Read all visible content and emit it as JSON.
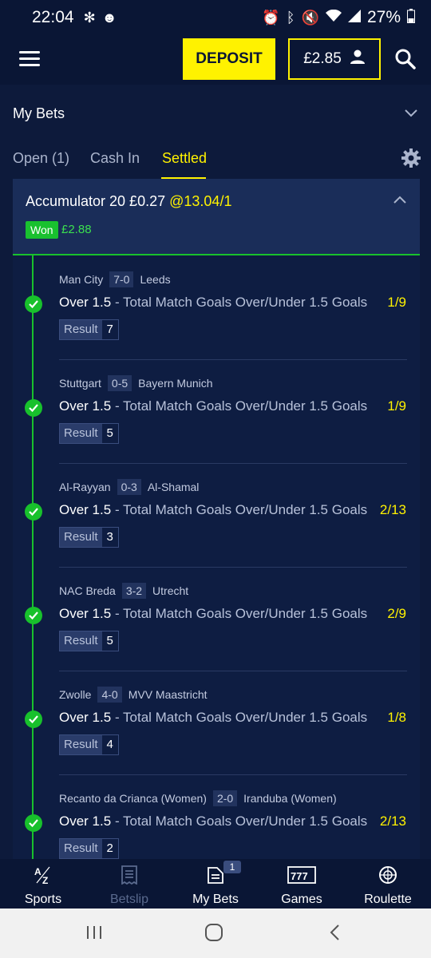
{
  "status_bar": {
    "time": "22:04",
    "battery": "27%"
  },
  "header": {
    "deposit_label": "DEPOSIT",
    "balance": "£2.85"
  },
  "my_bets": {
    "title": "My Bets",
    "tabs": [
      {
        "label": "Open (1)",
        "active": false
      },
      {
        "label": "Cash In",
        "active": false
      },
      {
        "label": "Settled",
        "active": true
      }
    ]
  },
  "bet": {
    "title": "Accumulator 20 £0.27",
    "odds": "@13.04/1",
    "status": "Won",
    "returns": "£2.88",
    "legs": [
      {
        "home": "Man City",
        "score": "7-0",
        "away": "Leeds",
        "pick": "Over 1.5",
        "market": "- Total Match Goals Over/Under 1.5 Goals",
        "odds": "1/9",
        "result_label": "Result",
        "result": "7"
      },
      {
        "home": "Stuttgart",
        "score": "0-5",
        "away": "Bayern Munich",
        "pick": "Over 1.5",
        "market": "- Total Match Goals Over/Under 1.5 Goals",
        "odds": "1/9",
        "result_label": "Result",
        "result": "5"
      },
      {
        "home": "Al-Rayyan",
        "score": "0-3",
        "away": "Al-Shamal",
        "pick": "Over 1.5",
        "market": "- Total Match Goals Over/Under 1.5 Goals",
        "odds": "2/13",
        "result_label": "Result",
        "result": "3"
      },
      {
        "home": "NAC Breda",
        "score": "3-2",
        "away": "Utrecht",
        "pick": "Over 1.5",
        "market": "- Total Match Goals Over/Under 1.5 Goals",
        "odds": "2/9",
        "result_label": "Result",
        "result": "5"
      },
      {
        "home": "Zwolle",
        "score": "4-0",
        "away": "MVV Maastricht",
        "pick": "Over 1.5",
        "market": "- Total Match Goals Over/Under 1.5 Goals",
        "odds": "1/8",
        "result_label": "Result",
        "result": "4"
      },
      {
        "home": "Recanto da Crianca (Women)",
        "score": "2-0",
        "away": "Iranduba (Women)",
        "pick": "Over 1.5",
        "market": "- Total Match Goals Over/Under 1.5 Goals",
        "odds": "2/13",
        "result_label": "Result",
        "result": "2"
      }
    ]
  },
  "bottom_nav": {
    "items": [
      {
        "label": "Sports",
        "icon": "az-icon"
      },
      {
        "label": "Betslip",
        "icon": "receipt-icon",
        "disabled": true
      },
      {
        "label": "My Bets",
        "icon": "mybets-icon",
        "badge": "1"
      },
      {
        "label": "Games",
        "icon": "slots-icon"
      },
      {
        "label": "Roulette",
        "icon": "roulette-icon"
      }
    ]
  },
  "colors": {
    "accent": "#fff200",
    "win": "#18c12c",
    "background": "#0d1a3b",
    "card": "#0e1d42"
  }
}
